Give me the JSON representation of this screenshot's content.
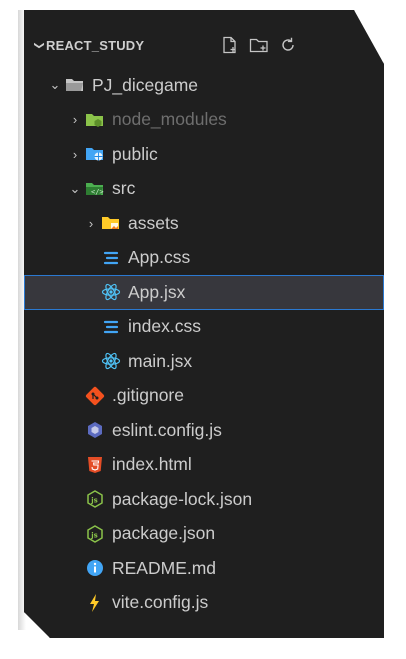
{
  "explorer": {
    "section_title": "REACT_STUDY",
    "actions": [
      {
        "name": "new-file-icon",
        "glyph": "🗋"
      },
      {
        "name": "new-folder-icon",
        "glyph": "🗀"
      },
      {
        "name": "refresh-icon",
        "glyph": "↻"
      }
    ],
    "tree": [
      {
        "label": "PJ_dicegame",
        "type": "folder-open",
        "level": 1
      },
      {
        "label": "node_modules",
        "type": "folder-node",
        "level": 2,
        "dim": true
      },
      {
        "label": "public",
        "type": "folder-public",
        "level": 2
      },
      {
        "label": "src",
        "type": "folder-src-open",
        "level": 2
      },
      {
        "label": "assets",
        "type": "folder-assets",
        "level": 3
      },
      {
        "label": "App.css",
        "type": "css",
        "level": 4
      },
      {
        "label": "App.jsx",
        "type": "react",
        "level": 4,
        "selected": true
      },
      {
        "label": "index.css",
        "type": "css",
        "level": 4
      },
      {
        "label": "main.jsx",
        "type": "react",
        "level": 4
      },
      {
        "label": ".gitignore",
        "type": "git",
        "level": 3
      },
      {
        "label": "eslint.config.js",
        "type": "eslint",
        "level": 3
      },
      {
        "label": "index.html",
        "type": "html",
        "level": 3
      },
      {
        "label": "package-lock.json",
        "type": "json",
        "level": 3
      },
      {
        "label": "package.json",
        "type": "json",
        "level": 3
      },
      {
        "label": "README.md",
        "type": "info",
        "level": 3
      },
      {
        "label": "vite.config.js",
        "type": "vite",
        "level": 3
      }
    ]
  },
  "colors": {
    "panel_bg": "#1f1f1f",
    "selected_bg": "#37373d",
    "selected_border": "#2b79d1",
    "text": "#cccccc",
    "dim_text": "#6e6e6e"
  }
}
